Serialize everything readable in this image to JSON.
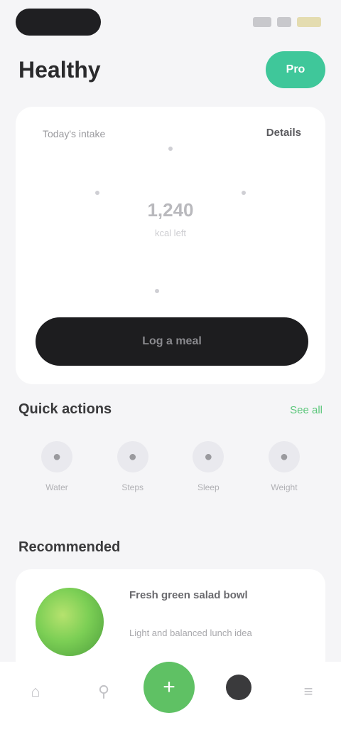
{
  "app": {
    "title": "Healthy"
  },
  "header": {
    "action_label": "Pro"
  },
  "card": {
    "left_label": "Today's intake",
    "right_label": "Details",
    "gauge_value": "1,240",
    "gauge_sub": "kcal left",
    "button_label": "Log a meal"
  },
  "quick": {
    "title": "Quick actions",
    "see_all": "See all",
    "items": [
      {
        "label": "Water",
        "icon": "drop-icon"
      },
      {
        "label": "Steps",
        "icon": "steps-icon"
      },
      {
        "label": "Sleep",
        "icon": "moon-icon"
      },
      {
        "label": "Weight",
        "icon": "scale-icon"
      }
    ]
  },
  "recommend": {
    "title": "Recommended",
    "item_title": "Fresh green salad bowl",
    "item_desc": "Light and balanced lunch idea"
  },
  "nav": {
    "items": [
      "home-icon",
      "search-icon",
      "plus-icon",
      "profile-icon",
      "menu-icon"
    ]
  },
  "colors": {
    "accent": "#3fc79a",
    "green": "#5fc164",
    "dark": "#1d1d1f"
  }
}
